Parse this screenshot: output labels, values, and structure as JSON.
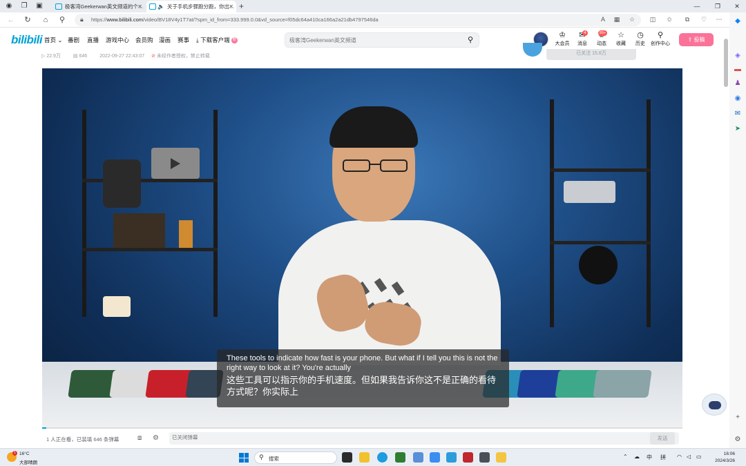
{
  "browser": {
    "tabs": [
      {
        "title": "极客湾Geekerwan英文频道的个…",
        "active": false
      },
      {
        "title": "关于手机步骤跑分跑，你出…",
        "active": true
      }
    ],
    "url_prefix": "https://",
    "url_domain": "www.bilibili.com",
    "url_rest": "/video/BV18V4y1T7at/?spm_id_from=333.999.0.0&vd_source=f05dc64a410ca166a2a21db4797546da"
  },
  "header": {
    "logo": "bilibili",
    "nav": [
      {
        "label": "首页 ⌄"
      },
      {
        "label": "番剧"
      },
      {
        "label": "直播"
      },
      {
        "label": "游戏中心"
      },
      {
        "label": "会员购"
      },
      {
        "label": "漫画"
      },
      {
        "label": "赛事"
      },
      {
        "label": "下载客户端",
        "badge": "新"
      }
    ],
    "search_placeholder": "极客湾Geekerwan英文频道",
    "icons": [
      {
        "label": "大会员",
        "icon": "crown-icon",
        "glyph": "♔"
      },
      {
        "label": "消息",
        "icon": "message-icon",
        "glyph": "✉",
        "count": "4"
      },
      {
        "label": "动态",
        "icon": "dynamic-icon",
        "glyph": "✺",
        "count": "99+"
      },
      {
        "label": "收藏",
        "icon": "star-icon",
        "glyph": "☆"
      },
      {
        "label": "历史",
        "icon": "history-icon",
        "glyph": "◷"
      },
      {
        "label": "创作中心",
        "icon": "bulb-icon",
        "glyph": "⚲"
      }
    ],
    "upload_label": "投稿"
  },
  "meta": {
    "views": "22.9万",
    "danmaku": "646",
    "date": "2022-09-27 22:43:07",
    "copyright": "未经作者授权，禁止转载",
    "follow_label": "已关注 15.8万"
  },
  "video": {
    "subtitle_en": "These tools to indicate how fast is your phone. But what if I tell you this is not the right way to look at it? You're actually",
    "subtitle_zh": "这些工具可以指示你的手机速度。但如果我告诉你这不是正确的看待方式呢？你实际上",
    "progress": 0.0
  },
  "danmaku_bar": {
    "info": "1 人正在看，已装填 646 条弹幕",
    "input_placeholder": "已关闭弹幕",
    "send_label": "发送"
  },
  "taskbar": {
    "weather_temp": "16°C",
    "weather_desc": "大部晴朗",
    "weather_badge": "1",
    "search_label": "搜索",
    "tray_lang": "中",
    "tray_ime": "拼",
    "time": "16:06",
    "date": "2024/3/26"
  },
  "colors": {
    "brand": "#00a1d6",
    "upload": "#fb7299"
  }
}
